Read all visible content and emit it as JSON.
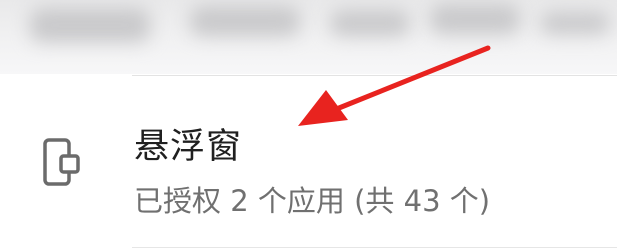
{
  "setting_item": {
    "title": "悬浮窗",
    "subtitle": "已授权 2 个应用 (共 43 个)",
    "icon": "floating-window-phone-icon"
  },
  "annotation": {
    "icon": "red-arrow",
    "color": "#e8231f"
  }
}
